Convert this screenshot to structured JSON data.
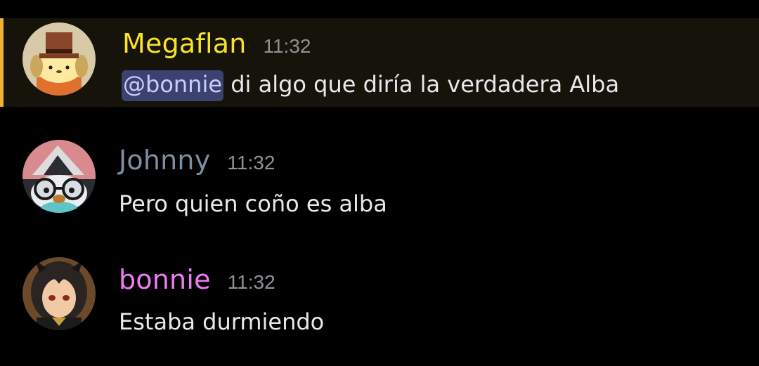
{
  "colors": {
    "highlight_bg": "#16130a",
    "highlight_bar": "#f0b232",
    "megaflan_name": "#f7e328",
    "johnny_name": "#7c8ea3",
    "bonnie_name": "#f07cf5",
    "mention_bg": "#3c4270",
    "mention_text": "#c9cdfb",
    "timestamp": "#8e9297",
    "message_text": "#e8e9ec"
  },
  "messages": [
    {
      "id": "megaflan",
      "username": "Megaflan",
      "timestamp": "11:32",
      "mention": "@bonnie",
      "text": "di algo que diría la verdadera Alba",
      "highlighted": true,
      "avatar": "pompompurin-avatar-icon"
    },
    {
      "id": "johnny",
      "username": "Johnny",
      "timestamp": "11:32",
      "text": "Pero quien coño es alba",
      "highlighted": false,
      "avatar": "penguin-glasses-avatar-icon"
    },
    {
      "id": "bonnie",
      "username": "bonnie",
      "timestamp": "11:32",
      "text": "Estaba durmiendo",
      "highlighted": false,
      "avatar": "anime-girl-avatar-icon"
    }
  ]
}
